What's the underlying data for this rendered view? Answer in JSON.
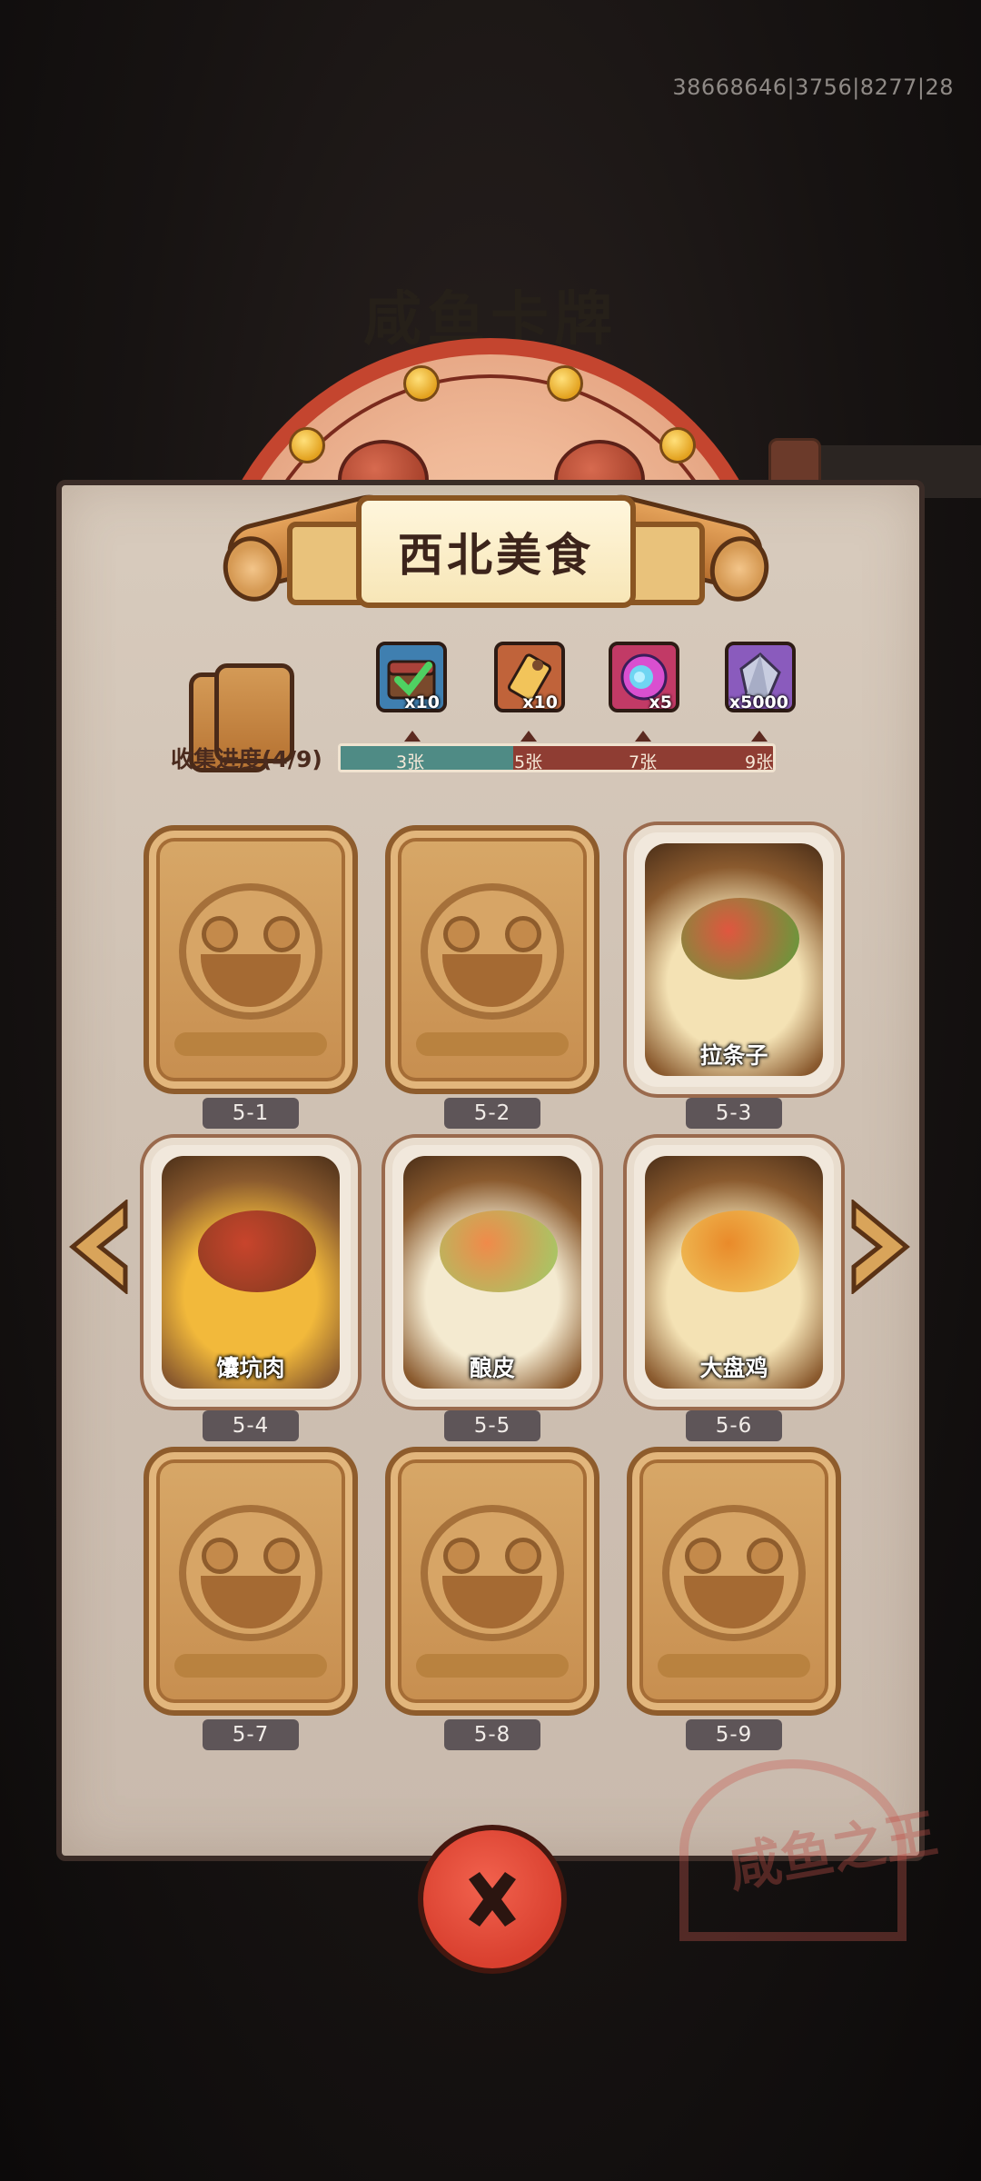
{
  "debug_id": "38668646|3756|8277|28",
  "background_title": "咸鱼卡牌",
  "album": {
    "title": "西北美食",
    "collect_label": "收集进度(4/9)",
    "progress": {
      "collected": 4,
      "total": 9
    }
  },
  "rewards": [
    {
      "name": "check-chest-icon",
      "count": "x10",
      "threshold": "3张",
      "color": "#3f7fb0"
    },
    {
      "name": "key-icon",
      "count": "x10",
      "threshold": "5张",
      "color": "#c0633a"
    },
    {
      "name": "portal-orb-icon",
      "count": "x5",
      "threshold": "7张",
      "color": "#c23a66"
    },
    {
      "name": "crystal-icon",
      "count": "x5000",
      "threshold": "9张",
      "color": "#8a5bbd"
    }
  ],
  "cards": [
    {
      "label": "5-1",
      "name": "",
      "owned": false
    },
    {
      "label": "5-2",
      "name": "",
      "owned": false
    },
    {
      "label": "5-3",
      "name": "拉条子",
      "owned": true
    },
    {
      "label": "5-4",
      "name": "馕坑肉",
      "owned": true
    },
    {
      "label": "5-5",
      "name": "酿皮",
      "owned": true
    },
    {
      "label": "5-6",
      "name": "大盘鸡",
      "owned": true
    },
    {
      "label": "5-7",
      "name": "",
      "owned": false
    },
    {
      "label": "5-8",
      "name": "",
      "owned": false
    },
    {
      "label": "5-9",
      "name": "",
      "owned": false
    }
  ],
  "seal_text": "咸鱼之王",
  "colors": {
    "accent_red": "#d9402f",
    "paper": "#d2c4b6",
    "progress_fill": "#4f8b85",
    "progress_bg": "#8f3d33"
  }
}
